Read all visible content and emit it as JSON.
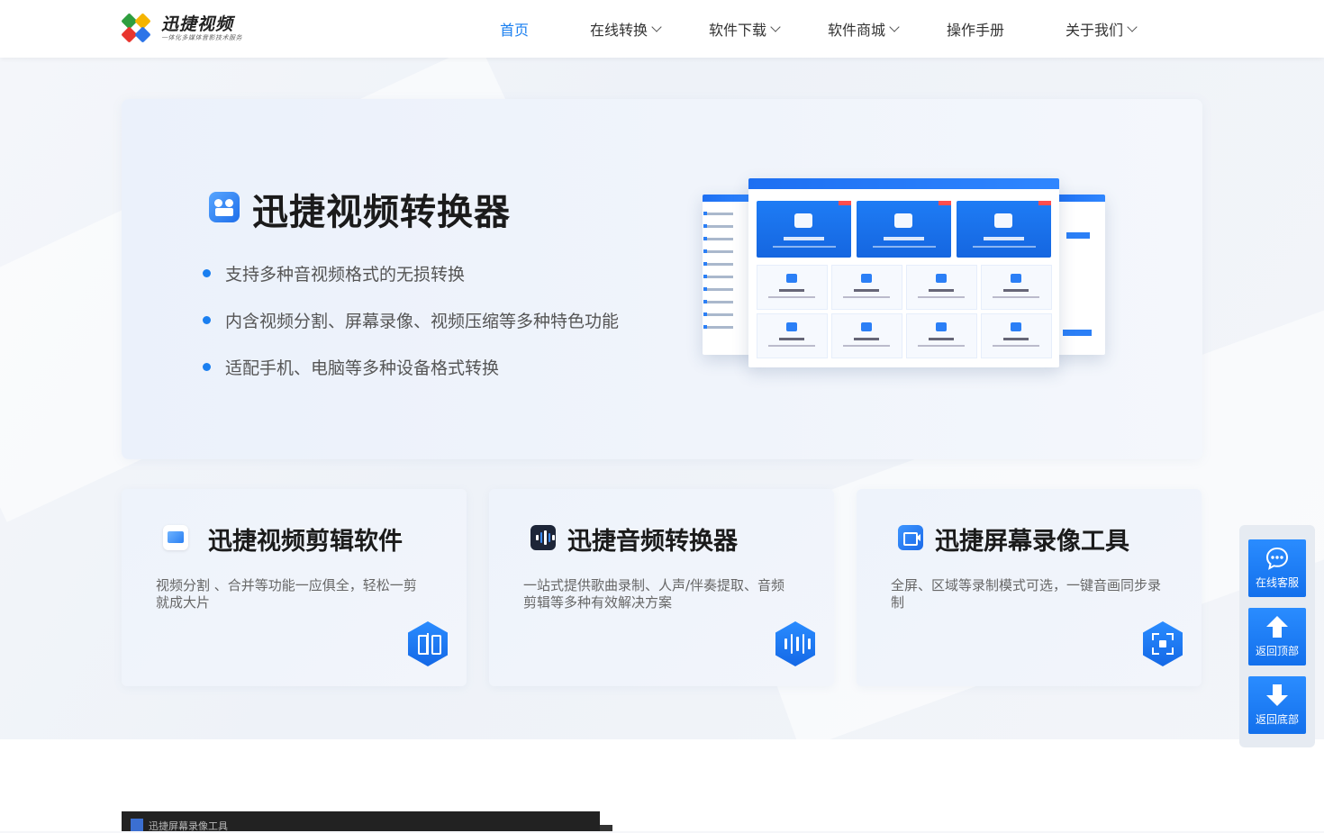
{
  "header": {
    "logo_name": "迅捷视频",
    "logo_slogan": "一体化多媒体音影技术服务",
    "nav": [
      {
        "label": "首页",
        "active": true,
        "has_dropdown": false
      },
      {
        "label": "在线转换",
        "active": false,
        "has_dropdown": true
      },
      {
        "label": "软件下载",
        "active": false,
        "has_dropdown": true
      },
      {
        "label": "软件商城",
        "active": false,
        "has_dropdown": true
      },
      {
        "label": "操作手册",
        "active": false,
        "has_dropdown": false
      },
      {
        "label": "关于我们",
        "active": false,
        "has_dropdown": true
      }
    ]
  },
  "hero": {
    "title": "迅捷视频转换器",
    "features": [
      "支持多种音视频格式的无损转换",
      "内含视频分割、屏幕录像、视频压缩等多种特色功能",
      "适配手机、电脑等多种设备格式转换"
    ]
  },
  "products": [
    {
      "title": "迅捷视频剪辑软件",
      "desc": "视频分割 、合并等功能一应俱全，轻松一剪就成大片",
      "icon": "video-editor-icon"
    },
    {
      "title": "迅捷音频转换器",
      "desc": "一站式提供歌曲录制、人声/伴奏提取、音频剪辑等多种有效解决方案",
      "icon": "audio-wave-icon"
    },
    {
      "title": "迅捷屏幕录像工具",
      "desc": "全屏、区域等录制模式可选，一键音画同步录制",
      "icon": "screen-record-icon"
    }
  ],
  "float_panel": {
    "buttons": [
      {
        "label": "在线客服",
        "icon": "chat-icon"
      },
      {
        "label": "返回顶部",
        "icon": "arrow-up-icon"
      },
      {
        "label": "返回底部",
        "icon": "arrow-down-icon"
      }
    ]
  },
  "preview": {
    "title": "迅捷屏幕录像工具"
  },
  "colors": {
    "accent": "#1a7ff0",
    "title": "#1b1b1b",
    "text": "#555555"
  }
}
